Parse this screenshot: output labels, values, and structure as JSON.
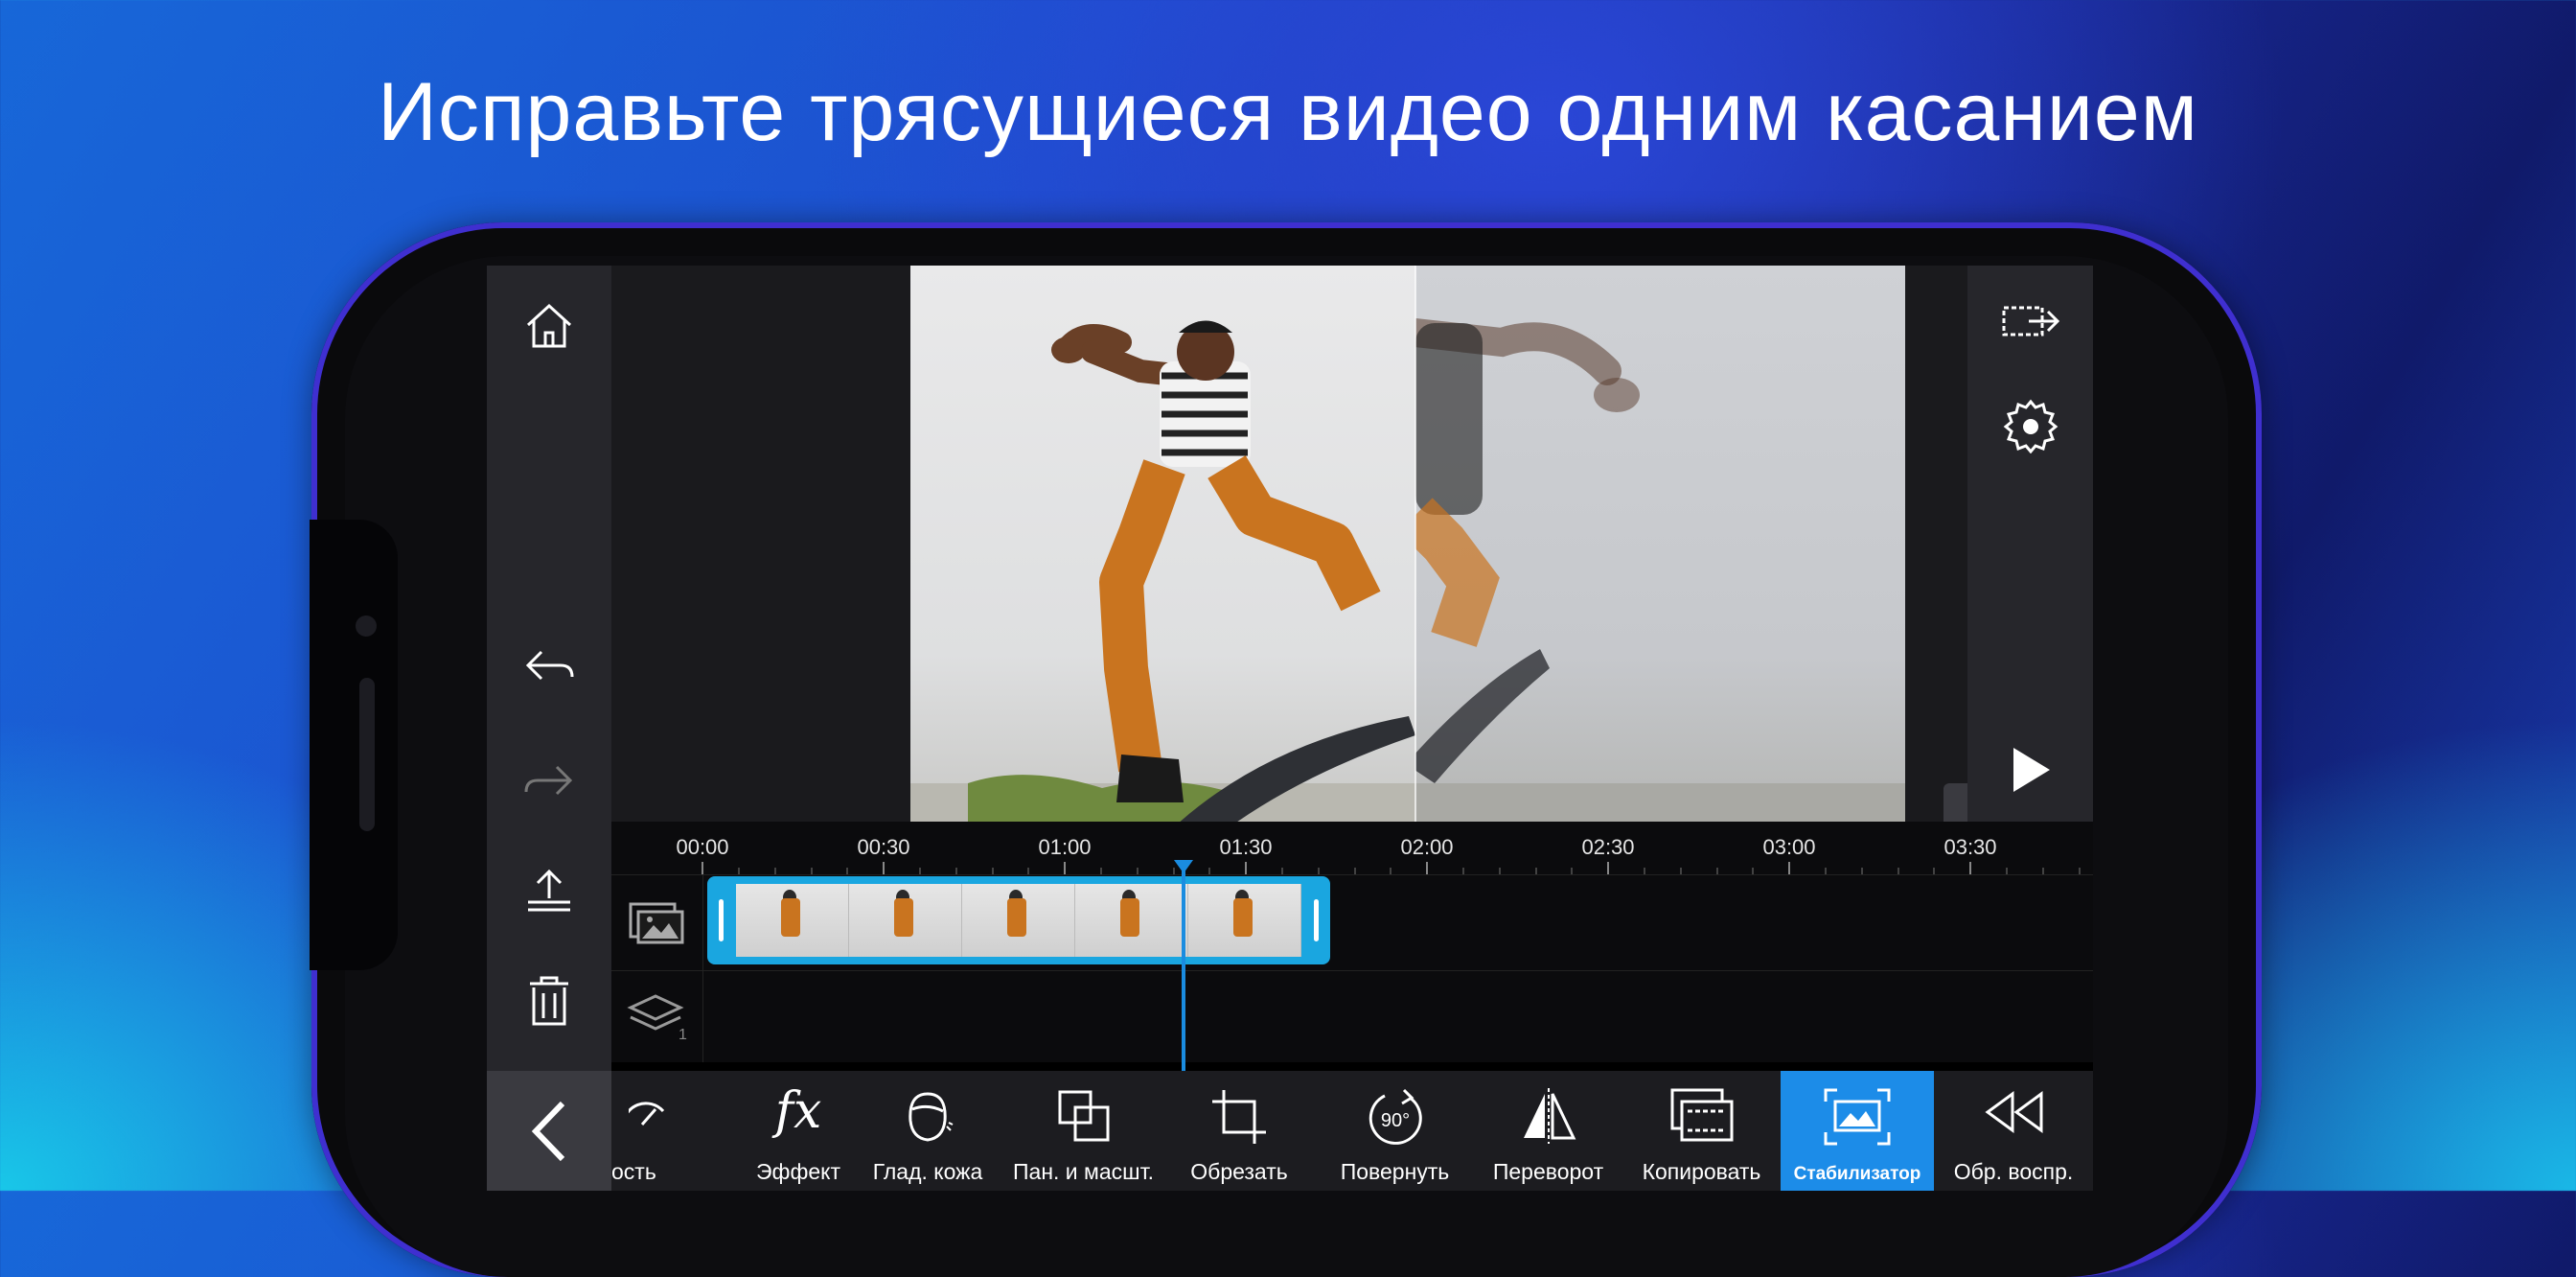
{
  "headline": "Исправьте трясущиеся видео одним касанием",
  "timeline": {
    "ticks": [
      "00:00",
      "00:30",
      "01:00",
      "01:30",
      "02:00",
      "02:30",
      "03:00",
      "03:30"
    ],
    "layer_count": "1"
  },
  "toolbar": {
    "items": [
      {
        "label": "ость",
        "icon": "speed-icon"
      },
      {
        "label": "Эффект",
        "icon": "fx-icon"
      },
      {
        "label": "Глад. кожа",
        "icon": "skin-smooth-icon"
      },
      {
        "label": "Пан. и масшт.",
        "icon": "pan-zoom-icon"
      },
      {
        "label": "Обрезать",
        "icon": "crop-icon"
      },
      {
        "label": "Повернуть",
        "icon": "rotate-icon"
      },
      {
        "label": "Переворот",
        "icon": "flip-icon"
      },
      {
        "label": "Копировать",
        "icon": "copy-icon"
      },
      {
        "label": "Стабилизатор",
        "icon": "stabilizer-icon",
        "active": true
      },
      {
        "label": "Обр. воспр.",
        "icon": "reverse-icon"
      }
    ],
    "rotate_badge": "90°",
    "fx_glyph": "fx"
  },
  "colors": {
    "accent": "#1c8ce8",
    "clip": "#1aa6e0"
  }
}
